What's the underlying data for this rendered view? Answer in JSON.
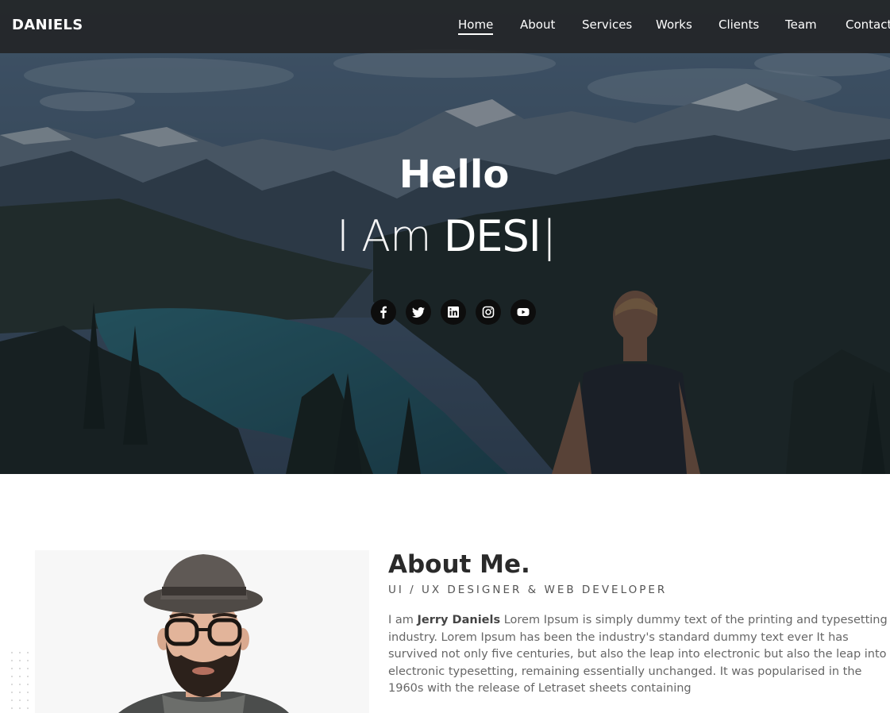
{
  "nav": {
    "brand": "DANIELS",
    "items": [
      {
        "label": "Home",
        "active": true
      },
      {
        "label": "About"
      },
      {
        "label": "Services"
      },
      {
        "label": "Works"
      },
      {
        "label": "Clients"
      },
      {
        "label": "Team"
      },
      {
        "label": "Contact"
      }
    ]
  },
  "hero": {
    "greeting": "Hello",
    "typed_prefix": "I Am",
    "typed_word": "DESI",
    "cursor": "|",
    "socials": [
      {
        "icon": "facebook-icon"
      },
      {
        "icon": "twitter-icon"
      },
      {
        "icon": "linkedin-icon"
      },
      {
        "icon": "instagram-icon"
      },
      {
        "icon": "youtube-icon"
      }
    ]
  },
  "about": {
    "title": "About Me.",
    "subtitle": "UI / UX DESIGNER & WEB DEVELOPER",
    "intro": "I am ",
    "name": "Jerry Daniels",
    "body": " Lorem Ipsum is simply dummy text of the printing and typesetting industry. Lorem Ipsum has been the industry's standard dummy text ever It has survived not only five centuries, but also the leap into electronic but also the leap into electronic typesetting, remaining essentially unchanged. It was popularised in the 1960s with the release of Letraset sheets containing"
  },
  "colors": {
    "nav_bg": "#202020",
    "hero_overlay": "#1b2330",
    "lake": "#2d6f7c",
    "heading": "#2a2a2a",
    "text": "#666666"
  }
}
